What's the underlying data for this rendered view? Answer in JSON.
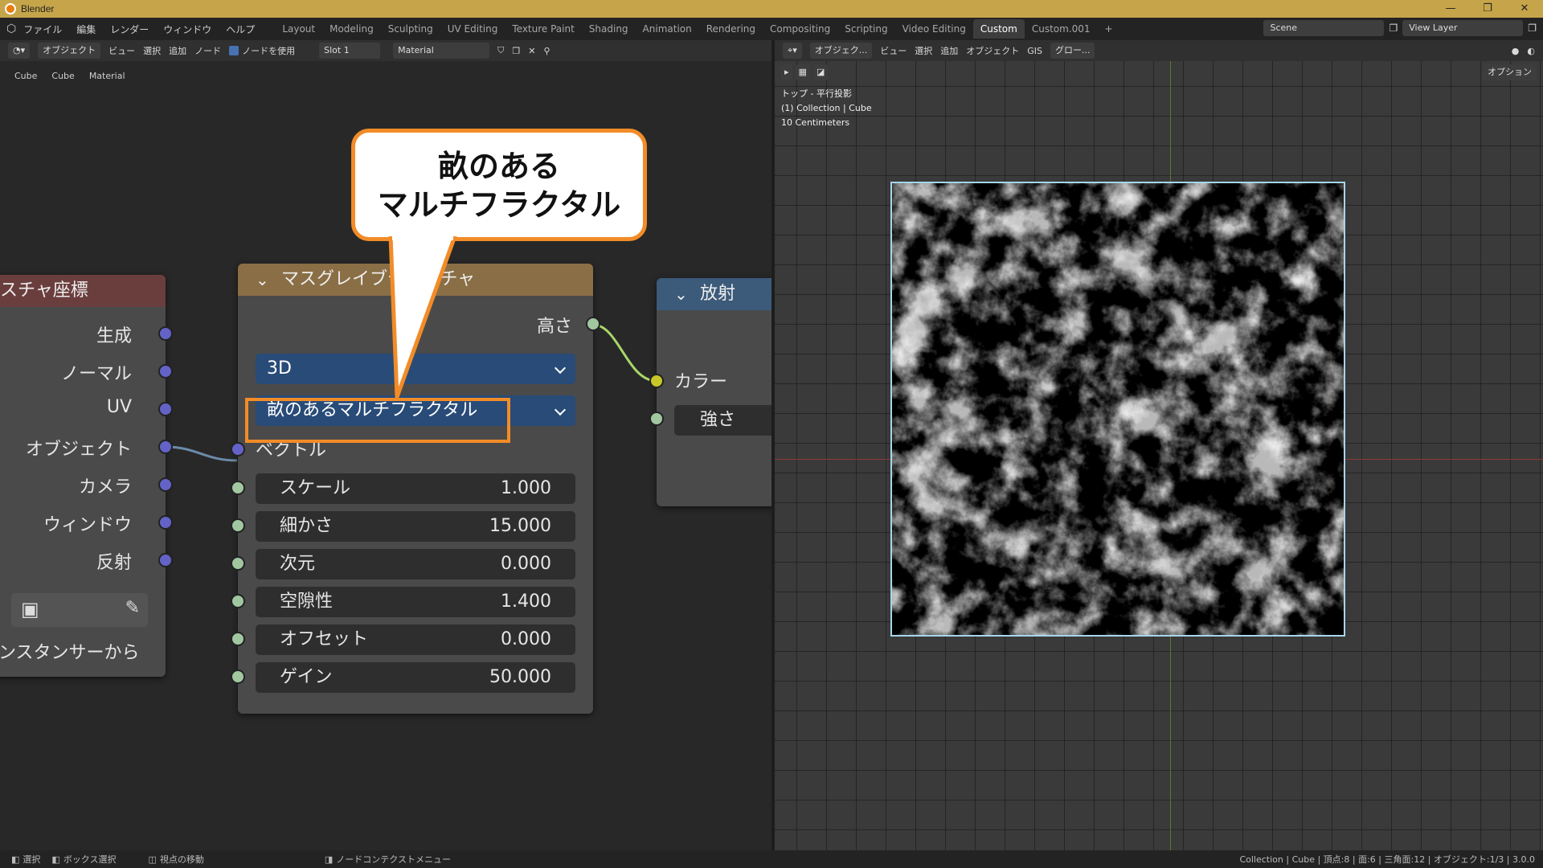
{
  "window": {
    "title": "Blender",
    "min": "—",
    "max": "❐",
    "close": "✕"
  },
  "menu": [
    "ファイル",
    "編集",
    "レンダー",
    "ウィンドウ",
    "ヘルプ"
  ],
  "workspaces": [
    "Layout",
    "Modeling",
    "Sculpting",
    "UV Editing",
    "Texture Paint",
    "Shading",
    "Animation",
    "Rendering",
    "Compositing",
    "Scripting",
    "Video Editing",
    "Custom",
    "Custom.001"
  ],
  "active_workspace": "Custom",
  "scene": "Scene",
  "view_layer": "View Layer",
  "node_header": {
    "mode": "オブジェクト",
    "view": "ビュー",
    "select": "選択",
    "add": "追加",
    "node": "ノード",
    "use_nodes": "ノードを使用",
    "slot": "Slot 1",
    "material": "Material"
  },
  "view_header": {
    "mode": "オブジェク...",
    "view": "ビュー",
    "select": "選択",
    "add": "追加",
    "object": "オブジェクト",
    "gis": "GIS",
    "transform": "グロー...",
    "options": "オプション"
  },
  "breadcrumb": [
    "Cube",
    "Cube",
    "Material"
  ],
  "node_texcoord": {
    "title": "スチャ座標",
    "outputs": [
      "生成",
      "ノーマル",
      "UV",
      "オブジェクト",
      "カメラ",
      "ウィンドウ",
      "反射"
    ],
    "instancer": "ンスタンサーから"
  },
  "node_musgrave": {
    "title": "マスグレイブテクスチャ",
    "output": "高さ",
    "dimensions": "3D",
    "type": "畝のあるマルチフラクタル",
    "vector": "ベクトル",
    "fields": [
      {
        "label": "スケール",
        "value": "1.000"
      },
      {
        "label": "細かさ",
        "value": "15.000"
      },
      {
        "label": "次元",
        "value": "0.000"
      },
      {
        "label": "空隙性",
        "value": "1.400"
      },
      {
        "label": "オフセット",
        "value": "0.000"
      },
      {
        "label": "ゲイン",
        "value": "50.000"
      }
    ]
  },
  "node_emission": {
    "title": "放射",
    "color": "カラー",
    "strength": "強さ"
  },
  "callout": {
    "line1": "畝のある",
    "line2": "マルチフラクタル"
  },
  "viewport_info": {
    "view": "トップ - 平行投影",
    "collection": "(1) Collection | Cube",
    "scale": "10 Centimeters"
  },
  "statusbar": {
    "select": "選択",
    "box_select": "ボックス選択",
    "move_view": "視点の移動",
    "context_menu": "ノードコンテクストメニュー",
    "stats": "Collection | Cube | 頂点:8 | 面:6 | 三角面:12 | オブジェクト:1/3 | 3.0.0"
  },
  "colors": {
    "accent": "#f28c28",
    "texture_header": "#8a6e45",
    "emission_header": "#3c5a7a",
    "dropdown": "#284b78"
  }
}
